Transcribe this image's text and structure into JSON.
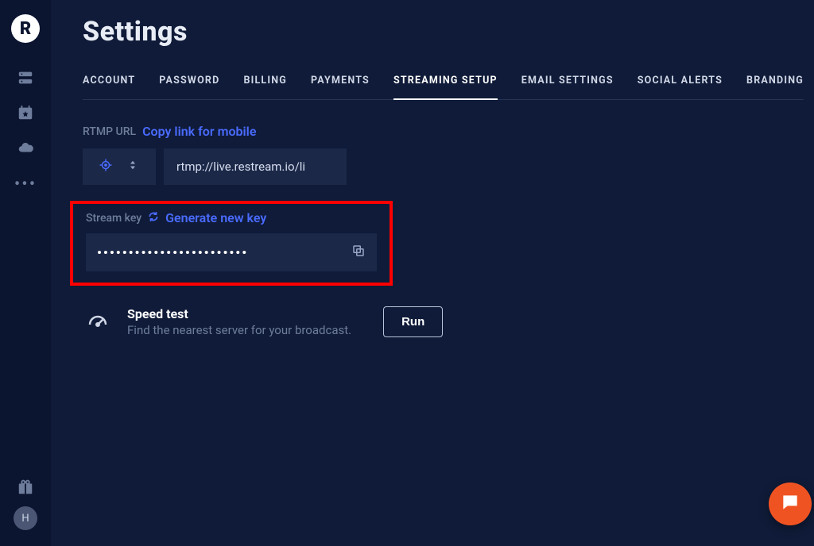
{
  "sidebar": {
    "logo_letter": "R",
    "avatar_initial": "H"
  },
  "page": {
    "title": "Settings"
  },
  "tabs": [
    {
      "label": "ACCOUNT"
    },
    {
      "label": "PASSWORD"
    },
    {
      "label": "BILLING"
    },
    {
      "label": "PAYMENTS"
    },
    {
      "label": "STREAMING SETUP",
      "active": true
    },
    {
      "label": "EMAIL SETTINGS"
    },
    {
      "label": "SOCIAL ALERTS"
    },
    {
      "label": "BRANDING"
    }
  ],
  "rtmp": {
    "label": "RTMP URL",
    "copy_link_text": "Copy link for mobile",
    "url_value": "rtmp://live.restream.io/li"
  },
  "stream_key": {
    "label": "Stream key",
    "generate_text": "Generate new key",
    "masked_value": "••••••••••••••••••••••••"
  },
  "speed_test": {
    "title": "Speed test",
    "subtitle": "Find the nearest server for your broadcast.",
    "button_label": "Run"
  }
}
